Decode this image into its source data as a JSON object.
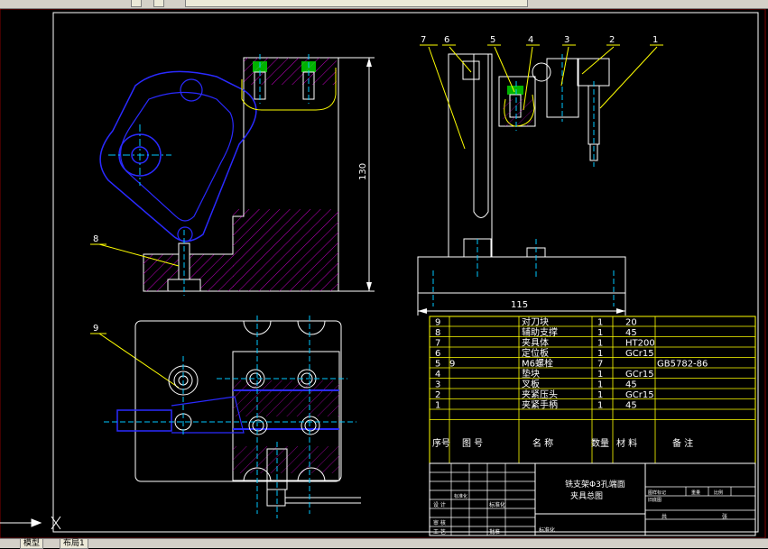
{
  "drawing": {
    "dimension_height": "130",
    "dimension_width": "115",
    "balloons": [
      "7",
      "6",
      "5",
      "4",
      "3",
      "2",
      "1",
      "8",
      "9"
    ]
  },
  "bom": {
    "rows": [
      {
        "no": "9",
        "name": "对刀块",
        "qty": "1",
        "material": "20",
        "note": ""
      },
      {
        "no": "8",
        "name": "辅助支撑",
        "qty": "1",
        "material": "45",
        "note": ""
      },
      {
        "no": "7",
        "name": "夹具体",
        "qty": "1",
        "material": "HT200",
        "note": ""
      },
      {
        "no": "6",
        "name": "定位板",
        "qty": "1",
        "material": "GCr15",
        "note": ""
      },
      {
        "no": "5",
        "code": "9",
        "name": "M6螺栓",
        "qty": "7",
        "material": "",
        "note": "GB5782-86"
      },
      {
        "no": "4",
        "name": "垫块",
        "qty": "1",
        "material": "GCr15",
        "note": ""
      },
      {
        "no": "3",
        "name": "叉板",
        "qty": "1",
        "material": "45",
        "note": ""
      },
      {
        "no": "2",
        "name": "夹紧压头",
        "qty": "1",
        "material": "GCr15",
        "note": ""
      },
      {
        "no": "1",
        "name": "夹紧手柄",
        "qty": "1",
        "material": "45",
        "note": ""
      }
    ],
    "header": {
      "no": "序号",
      "code": "图 号",
      "name": "名 称",
      "qty": "数量",
      "material": "材 料",
      "note": "备 注"
    }
  },
  "title_block": {
    "title_line1": "铣支架Φ3孔端面",
    "title_line2": "夹具总图",
    "left_labels": [
      "设 计",
      "审 核",
      "工 艺"
    ],
    "mid_labels": [
      "标准化",
      "标准化",
      "批准"
    ],
    "small_label": "标准化",
    "right_header": [
      "图样标记",
      "重量",
      "比例",
      "共",
      "张"
    ],
    "bottom_label": "旧底图"
  },
  "tabs": {
    "model": "模型",
    "layout1": "布局1"
  },
  "colors": {
    "frame": "#ffffff",
    "part": "#ffffff",
    "blue": "#2a2aff",
    "hatch": "#c000c0",
    "center": "#00c8ff",
    "leader": "#ffff00",
    "green": "#00ff00",
    "bom": "#ffff00"
  }
}
